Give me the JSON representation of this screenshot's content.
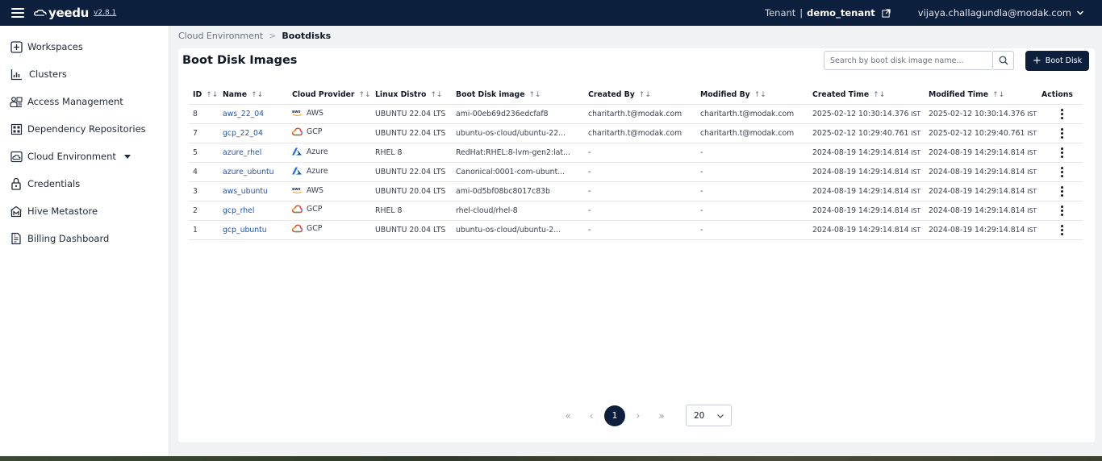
{
  "header": {
    "logo_text": "yeedu",
    "version": "v2.8.1",
    "tenant_label": "Tenant",
    "tenant_sep": "|",
    "tenant_name": "demo_tenant",
    "user_email": "vijaya.challagundla@modak.com"
  },
  "sidebar": {
    "items": [
      {
        "label": "Workspaces",
        "icon": "plus-square-icon"
      },
      {
        "label": "Clusters",
        "icon": "chart-icon"
      },
      {
        "label": "Access Management",
        "icon": "users-icon"
      },
      {
        "label": "Dependency Repositories",
        "icon": "repository-icon"
      },
      {
        "label": "Cloud Environment",
        "icon": "cloud-icon"
      },
      {
        "label": "Credentials",
        "icon": "lock-icon"
      },
      {
        "label": "Hive Metastore",
        "icon": "hive-icon"
      },
      {
        "label": "Billing Dashboard",
        "icon": "billing-icon"
      }
    ]
  },
  "breadcrumb": {
    "parent": "Cloud Environment",
    "separator": ">",
    "current": "Bootdisks"
  },
  "page": {
    "title": "Boot Disk Images",
    "search_placeholder": "Search by boot disk image name...",
    "add_button": "Boot Disk",
    "add_plus": "+"
  },
  "table": {
    "sort_glyph": "↑↓",
    "columns": [
      "ID",
      "Name",
      "Cloud Provider",
      "Linux Distro",
      "Boot Disk image",
      "Created By",
      "Modified By",
      "Created Time",
      "Modified Time",
      "Actions"
    ],
    "rows": [
      {
        "id": "8",
        "name": "aws_22_04",
        "provider": "AWS",
        "distro": "UBUNTU 22.04 LTS",
        "image": "ami-00eb69d236edcfaf8",
        "created_by": "charitarth.t@modak.com",
        "modified_by": "charitarth.t@modak.com",
        "created_time": "2025-02-12 10:30:14.376",
        "modified_time": "2025-02-12 10:30:14.376",
        "tz": "IST"
      },
      {
        "id": "7",
        "name": "gcp_22_04",
        "provider": "GCP",
        "distro": "UBUNTU 22.04 LTS",
        "image": "ubuntu-os-cloud/ubuntu-22...",
        "created_by": "charitarth.t@modak.com",
        "modified_by": "charitarth.t@modak.com",
        "created_time": "2025-02-12 10:29:40.761",
        "modified_time": "2025-02-12 10:29:40.761",
        "tz": "IST"
      },
      {
        "id": "5",
        "name": "azure_rhel",
        "provider": "Azure",
        "distro": "RHEL 8",
        "image": "RedHat:RHEL:8-lvm-gen2:lat...",
        "created_by": "-",
        "modified_by": "-",
        "created_time": "2024-08-19 14:29:14.814",
        "modified_time": "2024-08-19 14:29:14.814",
        "tz": "IST"
      },
      {
        "id": "4",
        "name": "azure_ubuntu",
        "provider": "Azure",
        "distro": "UBUNTU 22.04 LTS",
        "image": "Canonical:0001-com-ubunt...",
        "created_by": "-",
        "modified_by": "-",
        "created_time": "2024-08-19 14:29:14.814",
        "modified_time": "2024-08-19 14:29:14.814",
        "tz": "IST"
      },
      {
        "id": "3",
        "name": "aws_ubuntu",
        "provider": "AWS",
        "distro": "UBUNTU 20.04 LTS",
        "image": "ami-0d5bf08bc8017c83b",
        "created_by": "-",
        "modified_by": "-",
        "created_time": "2024-08-19 14:29:14.814",
        "modified_time": "2024-08-19 14:29:14.814",
        "tz": "IST"
      },
      {
        "id": "2",
        "name": "gcp_rhel",
        "provider": "GCP",
        "distro": "RHEL 8",
        "image": "rhel-cloud/rhel-8",
        "created_by": "-",
        "modified_by": "-",
        "created_time": "2024-08-19 14:29:14.814",
        "modified_time": "2024-08-19 14:29:14.814",
        "tz": "IST"
      },
      {
        "id": "1",
        "name": "gcp_ubuntu",
        "provider": "GCP",
        "distro": "UBUNTU 20.04 LTS",
        "image": "ubuntu-os-cloud/ubuntu-2...",
        "created_by": "-",
        "modified_by": "-",
        "created_time": "2024-08-19 14:29:14.814",
        "modified_time": "2024-08-19 14:29:14.814",
        "tz": "IST"
      }
    ]
  },
  "pagination": {
    "first": "«",
    "prev": "‹",
    "current": "1",
    "next": "›",
    "last": "»",
    "page_size": "20"
  },
  "colors": {
    "header_bg": "#0c1f3d",
    "link": "#1f56b3",
    "aws": "#f59e0b",
    "azure": "#1e6fd9"
  }
}
